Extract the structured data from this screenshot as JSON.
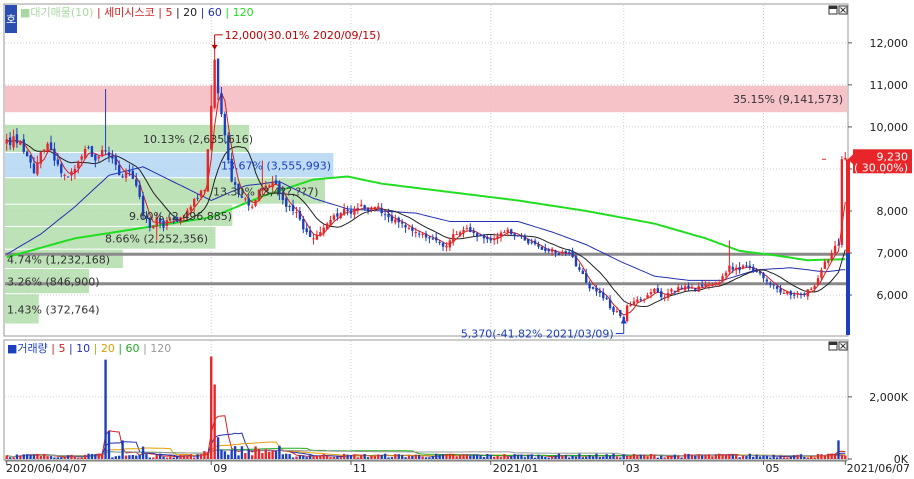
{
  "colors": {
    "up": "#e8262a",
    "down": "#1c3fc0",
    "ma5": "#d42020",
    "ma20": "#222222",
    "ma60": "#2430b0",
    "ma120": "#22dd22",
    "support": "#8a8a8a",
    "resist": "#f4b8c0",
    "profile": "#a8d8a0",
    "profile_blue": "#a8d0f0",
    "annot": "#1c3fc0",
    "annot_red": "#c00000"
  },
  "icons": [
    "home-icon",
    "maximize-icon",
    "close-icon"
  ],
  "price_panel": {
    "corner_label": "호",
    "legend": [
      {
        "text": "■대기매물(10)",
        "color": "#a8d8a0"
      },
      {
        "text": "| 세미시스코",
        "color": "#d42020"
      },
      {
        "text": "| 5",
        "color": "#d42020"
      },
      {
        "text": "| 20",
        "color": "#222222"
      },
      {
        "text": "| 60",
        "color": "#2430b0"
      },
      {
        "text": "| 120",
        "color": "#22dd22"
      }
    ],
    "current_price": "9,230",
    "current_change": "( 30.00%)",
    "high_annot": "12,000(30.01% 2020/09/15)",
    "low_annot": "5,370(-41.82% 2021/03/09)"
  },
  "volume_panel": {
    "legend": [
      {
        "text": "■거래량",
        "color": "#1c3fc0"
      },
      {
        "text": "| 5",
        "color": "#d42020"
      },
      {
        "text": "| 10",
        "color": "#2430b0"
      },
      {
        "text": "| 20",
        "color": "#e0a000"
      },
      {
        "text": "| 60",
        "color": "#22aa22"
      },
      {
        "text": "| 120",
        "color": "#999999"
      }
    ]
  },
  "chart_data": [
    {
      "type": "candlestick",
      "y_ticks": [
        "12,000",
        "11,000",
        "10,000",
        "9,000",
        "8,000",
        "7,000",
        "6,000"
      ],
      "y_tick_values": [
        12000,
        11000,
        10000,
        9000,
        8000,
        7000,
        6000
      ],
      "ylim": [
        5050,
        12900
      ],
      "x_ticks": [
        {
          "label": "2020/06/04/07",
          "index": 0
        },
        {
          "label": "09",
          "index": 60
        },
        {
          "label": "11",
          "index": 101
        },
        {
          "label": "2021/01",
          "index": 142
        },
        {
          "label": "03",
          "index": 181
        },
        {
          "label": "05",
          "index": 222
        },
        {
          "label": "2021/06/07",
          "index": 246
        }
      ],
      "support_lines": [
        6970,
        6270
      ],
      "resistance_zone": [
        10350,
        10980
      ],
      "volume_profile": [
        {
          "label": "35.15% (9,141,573)",
          "y_low": 10350,
          "y_high": 10980,
          "width_frac": 1.0
        },
        {
          "label": "10.13% (2,635,616)",
          "y_low": 9380,
          "y_high": 10050,
          "width_frac": 0.29
        },
        {
          "label": "13.67% (3,555,993)",
          "y_low": 8780,
          "y_high": 9380,
          "width_frac": 0.39
        },
        {
          "label": "13.30% (3,4??,??7)",
          "y_low": 8150,
          "y_high": 8780,
          "width_frac": 0.38
        },
        {
          "label": "9.60% (2,496,885)",
          "y_low": 7620,
          "y_high": 8150,
          "width_frac": 0.27
        },
        {
          "label": "8.66% (2,252,356)",
          "y_low": 7080,
          "y_high": 7620,
          "width_frac": 0.25
        },
        {
          "label": "4.74% (1,232,168)",
          "y_low": 6620,
          "y_high": 7080,
          "width_frac": 0.14
        },
        {
          "label": "3.26% (846,900)",
          "y_low": 6020,
          "y_high": 6620,
          "width_frac": 0.1
        },
        {
          "label": "1.43% (372,764)",
          "y_low": 5300,
          "y_high": 6020,
          "width_frac": 0.04
        }
      ],
      "close_anchors": [
        [
          0,
          9700
        ],
        [
          4,
          9650
        ],
        [
          6,
          9300
        ],
        [
          8,
          8900
        ],
        [
          10,
          9400
        ],
        [
          12,
          9600
        ],
        [
          14,
          9200
        ],
        [
          16,
          8900
        ],
        [
          18,
          8800
        ],
        [
          20,
          9000
        ],
        [
          22,
          9300
        ],
        [
          24,
          9500
        ],
        [
          26,
          9200
        ],
        [
          28,
          9450
        ],
        [
          30,
          9300
        ],
        [
          32,
          9100
        ],
        [
          34,
          8800
        ],
        [
          36,
          8950
        ],
        [
          38,
          8600
        ],
        [
          40,
          7900
        ],
        [
          42,
          7600
        ],
        [
          44,
          7850
        ],
        [
          46,
          7600
        ],
        [
          48,
          7800
        ],
        [
          50,
          7750
        ],
        [
          52,
          7900
        ],
        [
          54,
          8100
        ],
        [
          56,
          8300
        ],
        [
          58,
          8500
        ],
        [
          60,
          10500
        ],
        [
          61,
          11600
        ],
        [
          62,
          10800
        ],
        [
          63,
          10300
        ],
        [
          64,
          9800
        ],
        [
          66,
          8700
        ],
        [
          68,
          8400
        ],
        [
          70,
          8300
        ],
        [
          72,
          8100
        ],
        [
          74,
          8500
        ],
        [
          76,
          8600
        ],
        [
          78,
          8700
        ],
        [
          80,
          8400
        ],
        [
          82,
          8100
        ],
        [
          84,
          8000
        ],
        [
          86,
          7800
        ],
        [
          88,
          7500
        ],
        [
          90,
          7350
        ],
        [
          92,
          7500
        ],
        [
          94,
          7700
        ],
        [
          96,
          7900
        ],
        [
          98,
          7950
        ],
        [
          100,
          8000
        ],
        [
          102,
          8050
        ],
        [
          104,
          8150
        ],
        [
          106,
          8000
        ],
        [
          108,
          8100
        ],
        [
          110,
          7950
        ],
        [
          112,
          7850
        ],
        [
          114,
          7800
        ],
        [
          116,
          7700
        ],
        [
          118,
          7600
        ],
        [
          120,
          7500
        ],
        [
          122,
          7450
        ],
        [
          124,
          7350
        ],
        [
          126,
          7300
        ],
        [
          128,
          7150
        ],
        [
          130,
          7300
        ],
        [
          132,
          7450
        ],
        [
          134,
          7550
        ],
        [
          136,
          7500
        ],
        [
          138,
          7400
        ],
        [
          140,
          7350
        ],
        [
          142,
          7300
        ],
        [
          144,
          7400
        ],
        [
          146,
          7500
        ],
        [
          148,
          7450
        ],
        [
          150,
          7400
        ],
        [
          152,
          7300
        ],
        [
          154,
          7250
        ],
        [
          156,
          7150
        ],
        [
          158,
          7050
        ],
        [
          160,
          7100
        ],
        [
          162,
          6950
        ],
        [
          164,
          7000
        ],
        [
          166,
          6900
        ],
        [
          168,
          6600
        ],
        [
          170,
          6300
        ],
        [
          172,
          6150
        ],
        [
          174,
          6050
        ],
        [
          176,
          5900
        ],
        [
          178,
          5600
        ],
        [
          180,
          5500
        ],
        [
          181,
          5370
        ],
        [
          182,
          5750
        ],
        [
          184,
          5850
        ],
        [
          186,
          5900
        ],
        [
          188,
          6000
        ],
        [
          190,
          6150
        ],
        [
          192,
          5950
        ],
        [
          194,
          6050
        ],
        [
          196,
          6100
        ],
        [
          198,
          6150
        ],
        [
          200,
          6150
        ],
        [
          202,
          6100
        ],
        [
          204,
          6200
        ],
        [
          206,
          6250
        ],
        [
          208,
          6300
        ],
        [
          210,
          6450
        ],
        [
          212,
          6700
        ],
        [
          214,
          6650
        ],
        [
          216,
          6700
        ],
        [
          218,
          6650
        ],
        [
          220,
          6550
        ],
        [
          222,
          6400
        ],
        [
          224,
          6250
        ],
        [
          226,
          6150
        ],
        [
          228,
          6050
        ],
        [
          230,
          6000
        ],
        [
          232,
          6050
        ],
        [
          234,
          6000
        ],
        [
          236,
          6150
        ],
        [
          238,
          6400
        ],
        [
          240,
          6800
        ],
        [
          242,
          7000
        ],
        [
          244,
          7200
        ],
        [
          245,
          9230
        ]
      ],
      "highs": {
        "61": 12000,
        "60": 11000,
        "29": 10900,
        "81": 8600,
        "75": 9200,
        "212": 7300,
        "244": 7350
      },
      "lows": {
        "181": 5370,
        "44": 7300,
        "90": 7200
      },
      "ma120_anchors": [
        [
          0,
          6900
        ],
        [
          20,
          7350
        ],
        [
          40,
          7600
        ],
        [
          60,
          7850
        ],
        [
          75,
          8350
        ],
        [
          90,
          8750
        ],
        [
          100,
          8820
        ],
        [
          110,
          8650
        ],
        [
          130,
          8450
        ],
        [
          150,
          8250
        ],
        [
          170,
          8000
        ],
        [
          190,
          7700
        ],
        [
          205,
          7350
        ],
        [
          215,
          7050
        ],
        [
          225,
          6950
        ],
        [
          235,
          6830
        ],
        [
          245,
          6850
        ]
      ],
      "ma60_anchors": [
        [
          0,
          6970
        ],
        [
          10,
          7450
        ],
        [
          20,
          8100
        ],
        [
          30,
          8850
        ],
        [
          40,
          9050
        ],
        [
          50,
          8650
        ],
        [
          60,
          8250
        ],
        [
          70,
          8600
        ],
        [
          80,
          8700
        ],
        [
          90,
          8300
        ],
        [
          100,
          8050
        ],
        [
          110,
          8000
        ],
        [
          120,
          7950
        ],
        [
          130,
          7750
        ],
        [
          140,
          7750
        ],
        [
          150,
          7750
        ],
        [
          160,
          7500
        ],
        [
          170,
          7200
        ],
        [
          180,
          6800
        ],
        [
          190,
          6450
        ],
        [
          200,
          6350
        ],
        [
          210,
          6350
        ],
        [
          220,
          6600
        ],
        [
          230,
          6650
        ],
        [
          240,
          6550
        ],
        [
          245,
          6600
        ]
      ],
      "annotations": [
        {
          "text": "12,000(30.01% 2020/09/15)",
          "index": 61,
          "value": 12000
        },
        {
          "text": "5,370(-41.82% 2021/03/09)",
          "index": 181,
          "value": 5370
        }
      ],
      "last": {
        "price": 9230,
        "change_pct": 30.0
      }
    },
    {
      "type": "bar",
      "y_ticks": [
        "2,000K",
        "0K"
      ],
      "y_tick_values": [
        2000000,
        0
      ],
      "ylim": [
        0,
        3800000
      ],
      "spikes": {
        "29": 3200000,
        "30": 900000,
        "34": 600000,
        "40": 400000,
        "60": 3300000,
        "61": 2400000,
        "62": 700000,
        "63": 300000,
        "64": 250000,
        "244": 600000,
        "212": 150000
      },
      "base_volume": 110000
    }
  ]
}
